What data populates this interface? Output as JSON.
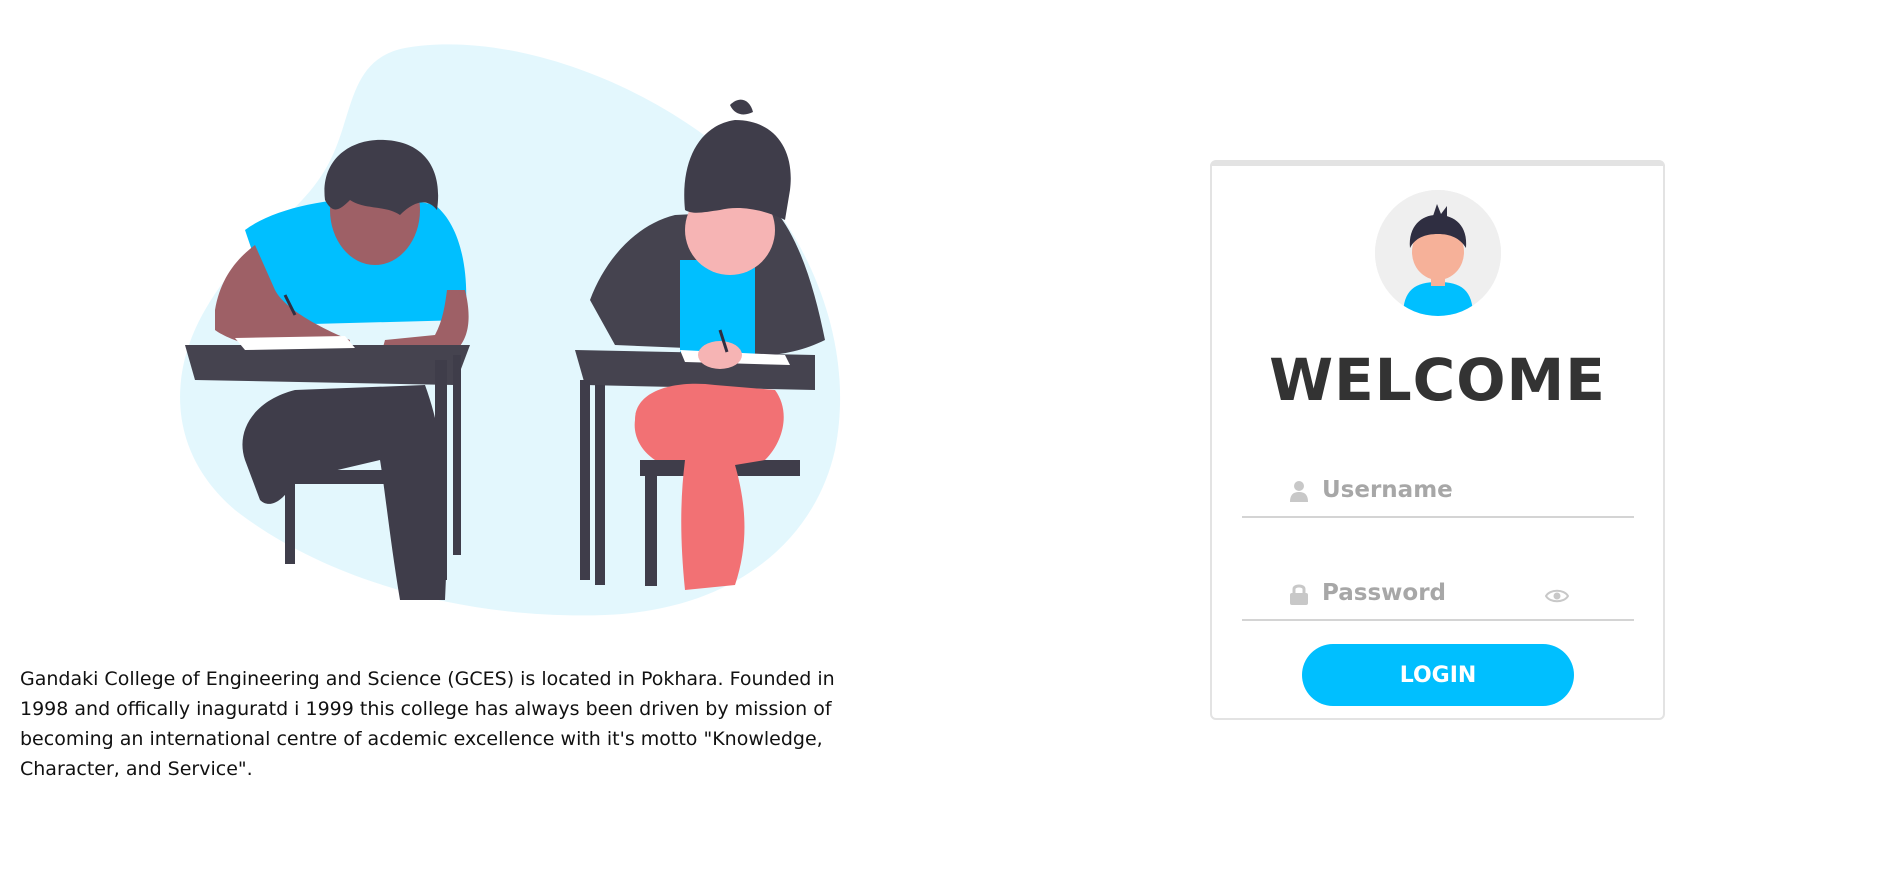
{
  "illustration": {
    "name": "students-writing-exam-illustration"
  },
  "description": {
    "text": "Gandaki College of Engineering and Science (GCES) is located in Pokhara. Founded in 1998 and offically inaguratd i 1999 this college has always been driven by mission of becoming an international centre of acdemic excellence with it's motto \"Knowledge, Character, and Service\"."
  },
  "login": {
    "avatar_icon": "user-avatar-icon",
    "welcome": "WELCOME",
    "username": {
      "icon": "user-icon",
      "placeholder": "Username",
      "value": ""
    },
    "password": {
      "icon": "lock-icon",
      "placeholder": "Password",
      "value": "",
      "toggle_icon": "eye-icon"
    },
    "button_label": "LOGIN"
  },
  "colors": {
    "accent": "#00bfff",
    "heading": "#333333",
    "placeholder": "#a7a7a7",
    "blob": "#e3f7fd"
  }
}
